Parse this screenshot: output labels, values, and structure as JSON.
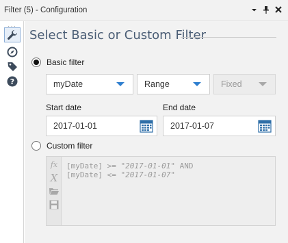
{
  "window": {
    "title": "Filter (5) - Configuration",
    "controls": [
      "chevron-down-icon",
      "pin-icon",
      "close-icon"
    ]
  },
  "sidebar": {
    "items": [
      {
        "icon": "wrench-icon",
        "active": true
      },
      {
        "icon": "compass-icon",
        "active": false
      },
      {
        "icon": "tag-icon",
        "active": false
      },
      {
        "icon": "help-icon",
        "active": false
      }
    ]
  },
  "main": {
    "heading": "Select Basic or Custom Filter",
    "basic_filter": {
      "label": "Basic filter",
      "selected": true,
      "field": "myDate",
      "operator": "Range",
      "extra": "Fixed",
      "start_label": "Start date",
      "start_value": "2017-01-01",
      "end_label": "End date",
      "end_value": "2017-01-07"
    },
    "custom_filter": {
      "label": "Custom filter",
      "selected": false,
      "line1_field": "[myDate]",
      "line1_op": " >= ",
      "line1_value": "\"2017-01-01\"",
      "line1_tail": " AND",
      "line2_field": "[myDate]",
      "line2_op": " <= ",
      "line2_value": "\"2017-01-07\""
    }
  },
  "colors": {
    "heading": "#4a5d75",
    "accent": "#2f7fcf",
    "panel_bg": "#f2f2f2"
  }
}
